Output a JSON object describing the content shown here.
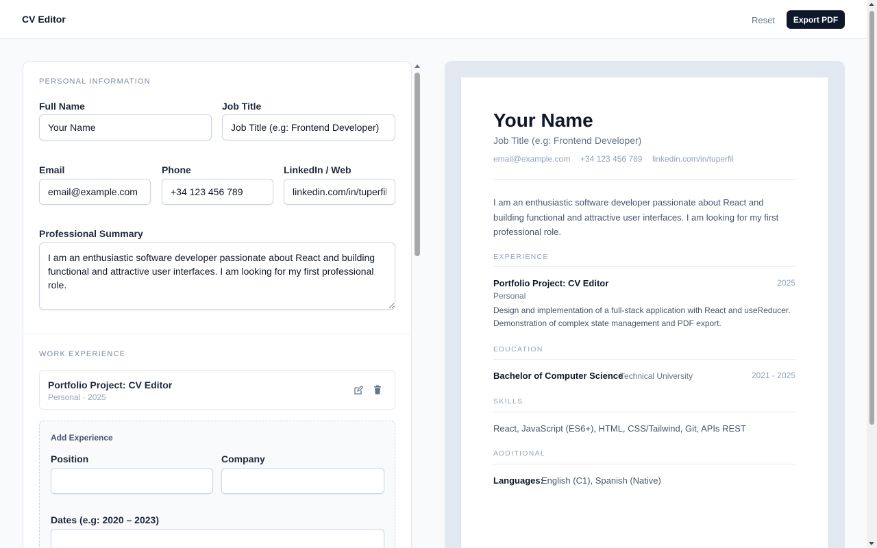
{
  "header": {
    "title": "CV Editor",
    "reset_label": "Reset",
    "export_label": "Export PDF"
  },
  "editor": {
    "personal": {
      "heading": "PERSONAL INFORMATION",
      "full_name_label": "Full Name",
      "full_name_value": "Your Name",
      "job_title_label": "Job Title",
      "job_title_value": "Job Title (e.g: Frontend Developer)",
      "email_label": "Email",
      "email_value": "email@example.com",
      "phone_label": "Phone",
      "phone_value": "+34 123 456 789",
      "linkedin_label": "LinkedIn / Web",
      "linkedin_value": "linkedin.com/in/tuperfil",
      "summary_label": "Professional Summary",
      "summary_value": "I am an enthusiastic software developer passionate about React and building functional and attractive user interfaces. I am looking for my first professional role."
    },
    "experience": {
      "heading": "WORK EXPERIENCE",
      "items": [
        {
          "title": "Portfolio Project: CV Editor",
          "subtitle": "Personal · 2025"
        }
      ],
      "add": {
        "title": "Add Experience",
        "position_label": "Position",
        "position_value": "",
        "company_label": "Company",
        "company_value": "",
        "dates_label": "Dates (e.g: 2020 – 2023)",
        "dates_value": ""
      }
    }
  },
  "preview": {
    "name": "Your Name",
    "job_title": "Job Title (e.g: Frontend Developer)",
    "email": "email@example.com",
    "phone": "+34 123 456 789",
    "linkedin": "linkedin.com/in/tuperfil",
    "summary": "I am an enthusiastic software developer passionate about React and building functional and attractive user interfaces. I am looking for my first professional role.",
    "experience_heading": "EXPERIENCE",
    "experience": [
      {
        "title": "Portfolio Project: CV Editor",
        "date": "2025",
        "company": "Personal",
        "description": "Design and implementation of a full-stack application with React and useReducer. Demonstration of complex state management and PDF export."
      }
    ],
    "education_heading": "EDUCATION",
    "education": [
      {
        "degree": "Bachelor of Computer Science",
        "school": "Technical University",
        "dates": "2021 - 2025"
      }
    ],
    "skills_heading": "SKILLS",
    "skills": "React, JavaScript (ES6+), HTML, CSS/Tailwind, Git, APIs REST",
    "additional_heading": "ADDITIONAL",
    "languages_label": "Languages:",
    "languages_value": "English (C1), Spanish (Native)"
  },
  "icons": {
    "edit": "edit-icon",
    "delete": "trash-icon"
  },
  "colors": {
    "primary": "#0f172a",
    "muted": "#94a3b8",
    "preview_frame": "#e2e8f0"
  }
}
